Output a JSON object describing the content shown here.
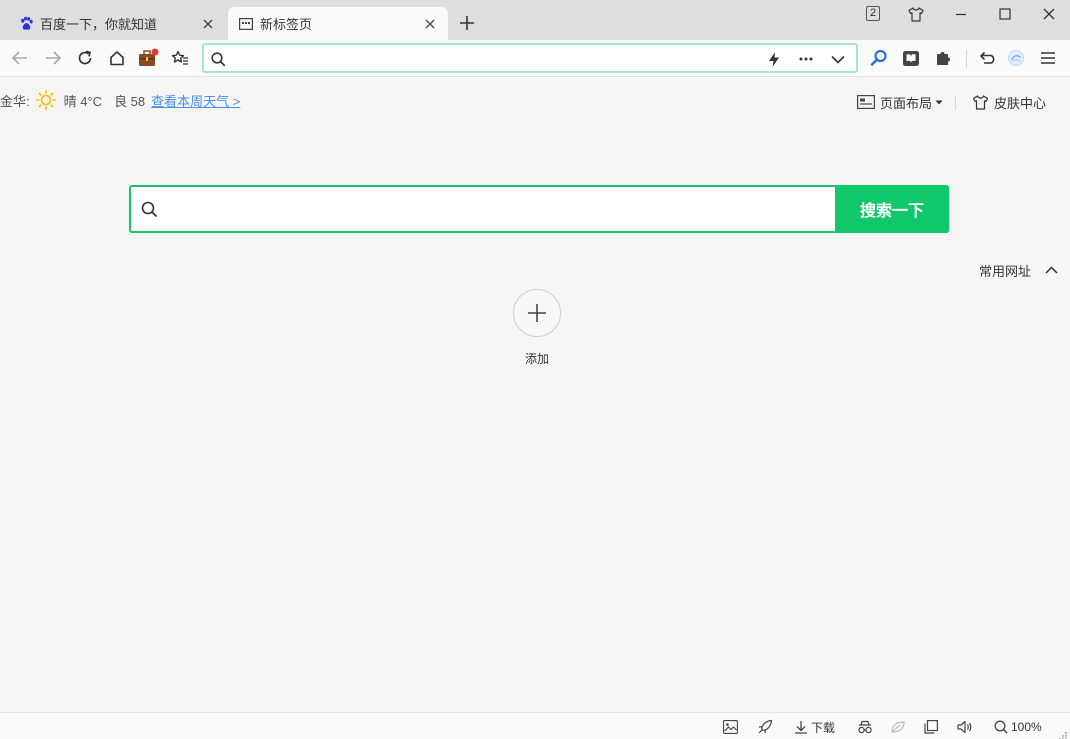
{
  "tabs": [
    {
      "title": "百度一下，你就知道",
      "icon": "baidu-paw-icon",
      "active": false
    },
    {
      "title": "新标签页",
      "icon": "newtab-page-icon",
      "active": true
    }
  ],
  "window": {
    "tab_count": "2"
  },
  "weather": {
    "city": "金华:",
    "condition": "晴 4°C",
    "aqi": "良 58",
    "link": "查看本周天气 >"
  },
  "topright": {
    "layout_label": "页面布局",
    "skin_label": "皮肤中心"
  },
  "search": {
    "value": "",
    "placeholder": "",
    "button_label": "搜索一下"
  },
  "urlbar": {
    "value": "",
    "placeholder": ""
  },
  "common_sites": {
    "label": "常用网址"
  },
  "quick_add": {
    "label": "添加"
  },
  "statusbar": {
    "download_label": "下载",
    "zoom": "100%"
  },
  "colors": {
    "accent_green": "#10c86b",
    "search_border": "#1ec16b",
    "urlbar_border": "#a7e6c4",
    "link_blue": "#4a90e2",
    "tabstrip_bg": "#dedede",
    "page_bg": "#f5f5f5"
  }
}
